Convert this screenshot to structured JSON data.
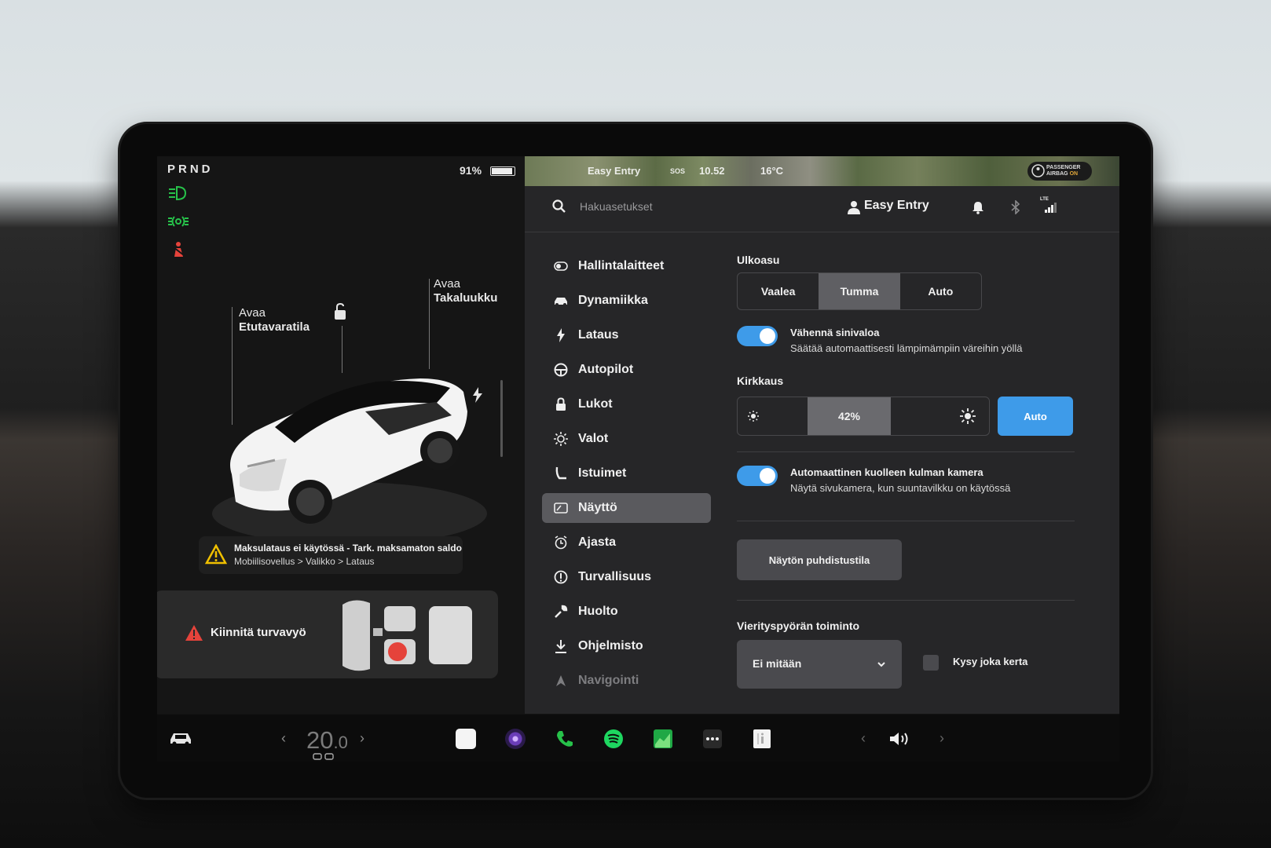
{
  "left_panel": {
    "gear": "PRND",
    "battery_percent": "91%",
    "callouts": {
      "front_trunk_1": "Avaa",
      "front_trunk_2": "Etutavaratila",
      "rear_trunk_1": "Avaa",
      "rear_trunk_2": "Takaluukku"
    },
    "alert": {
      "title": "Maksulataus ei käytössä - Tark. maksamaton saldo",
      "subtitle": "Mobiilisovellus > Valikko > Lataus"
    },
    "seatbelt_alert": "Kiinnitä turvavyö"
  },
  "status_bar": {
    "map_profile": "Easy Entry",
    "time": "10.52",
    "temperature": "16°C",
    "sos": "SOS",
    "airbag_line1": "PASSENGER",
    "airbag_line2": "AIRBAG",
    "airbag_state": "ON"
  },
  "header": {
    "search_placeholder": "Hakuasetukset",
    "profile_name": "Easy Entry",
    "lte_label": "LTE"
  },
  "menu": {
    "items": [
      {
        "label": "Hallintalaitteet",
        "icon": "toggle-icon"
      },
      {
        "label": "Dynamiikka",
        "icon": "car-icon"
      },
      {
        "label": "Lataus",
        "icon": "bolt-icon"
      },
      {
        "label": "Autopilot",
        "icon": "steering-wheel-icon"
      },
      {
        "label": "Lukot",
        "icon": "lock-icon"
      },
      {
        "label": "Valot",
        "icon": "sun-icon"
      },
      {
        "label": "Istuimet",
        "icon": "seat-icon"
      },
      {
        "label": "Näyttö",
        "icon": "display-icon"
      },
      {
        "label": "Ajasta",
        "icon": "alarm-clock-icon"
      },
      {
        "label": "Turvallisuus",
        "icon": "info-circle-icon"
      },
      {
        "label": "Huolto",
        "icon": "wrench-icon"
      },
      {
        "label": "Ohjelmisto",
        "icon": "download-icon"
      },
      {
        "label": "Navigointi",
        "icon": "navigation-arrow-icon"
      }
    ],
    "active_index": 7
  },
  "display_settings": {
    "appearance_label": "Ulkoasu",
    "appearance_options": [
      "Vaalea",
      "Tumma",
      "Auto"
    ],
    "appearance_selected": "Tumma",
    "blue_light_title": "Vähennä sinivaloa",
    "blue_light_subtitle": "Säätää automaattisesti lämpimämpiin väreihin yöllä",
    "blue_light_enabled": true,
    "brightness_label": "Kirkkaus",
    "brightness_value": "42%",
    "brightness_level": 0.42,
    "brightness_auto_label": "Auto",
    "blind_spot_title": "Automaattinen kuolleen kulman kamera",
    "blind_spot_subtitle": "Näytä sivukamera, kun suuntavilkku on käytössä",
    "blind_spot_enabled": true,
    "clean_mode_button": "Näytön puhdistustila",
    "scroll_wheel_label": "Vierityspyörän toiminto",
    "scroll_wheel_value": "Ei mitään",
    "ask_every_time_label": "Kysy joka kerta",
    "ask_every_time_checked": false
  },
  "dock": {
    "temperature_main": "20",
    "temperature_decimal": ".0"
  },
  "colors": {
    "accent_blue": "#3e9be9",
    "indicator_green": "#27c24a",
    "warning_red": "#e5433b"
  }
}
